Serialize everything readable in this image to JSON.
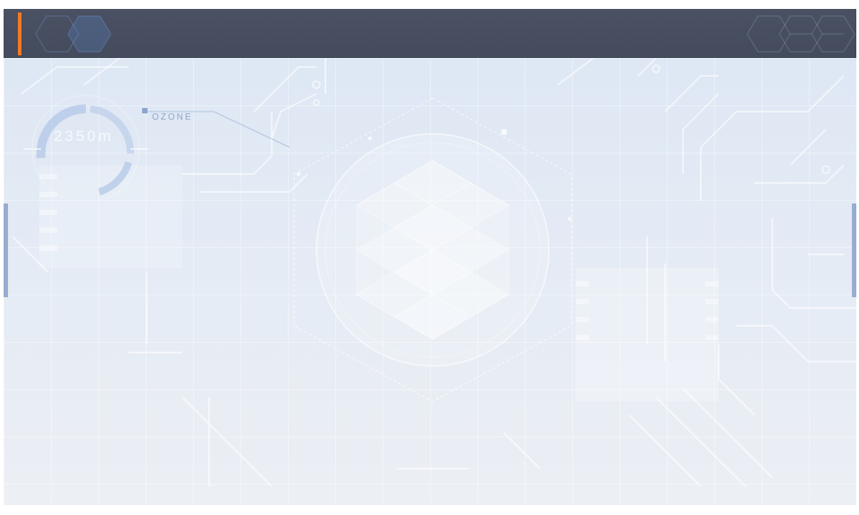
{
  "header": {
    "accent_color": "#f07a28",
    "background_color": "#454c5e"
  },
  "gauge": {
    "label": "",
    "value": "2350m"
  },
  "ozone": {
    "label": "OZONE"
  },
  "info_top_right": {
    "lines": [
      "",
      "",
      "",
      "",
      "",
      "",
      "",
      ""
    ]
  },
  "info_bottom_left": {
    "lines": [
      "",
      "",
      "",
      "",
      "",
      "",
      "",
      "",
      "",
      "",
      ""
    ]
  },
  "colors": {
    "background": "#dfe7f3",
    "side_tab": "#98add0",
    "ozone_accent": "#8ea4cc"
  }
}
